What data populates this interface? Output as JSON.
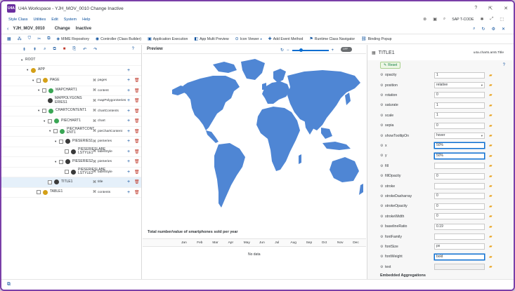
{
  "window": {
    "app_icon_text": "U4A",
    "title": "U4A Workspace - YJH_MOV_0010 Change Inactive",
    "controls": [
      "?",
      "⇱",
      "✕"
    ]
  },
  "menu": {
    "items": [
      "Style Class",
      "Utilities",
      "Edit",
      "System",
      "Help"
    ],
    "tcode_placeholder": "SAP T-CODE"
  },
  "header": {
    "title": "YJH_MOV_0010",
    "mode": "Change",
    "status": "Inactive"
  },
  "toolbar": {
    "items": [
      {
        "icon": "grid-icon",
        "label": ""
      },
      {
        "icon": "code-icon",
        "label": ""
      },
      {
        "icon": "shield-icon",
        "label": ""
      },
      {
        "icon": "scissors-icon",
        "label": ""
      },
      {
        "icon": "copy-icon",
        "label": ""
      },
      {
        "icon": "cube-icon",
        "label": "MIME Repository"
      },
      {
        "icon": "controller-icon",
        "label": "Controller (Class Builder)"
      },
      {
        "icon": "run-icon",
        "label": "Application Execution"
      },
      {
        "icon": "multi-preview-icon",
        "label": "App Multi Preview"
      },
      {
        "icon": "icon-viewer-icon",
        "label": "Icon Viewer"
      },
      {
        "icon": "event-icon",
        "label": "Add Event Method"
      },
      {
        "icon": "runtime-icon",
        "label": "Runtime Class Navigator"
      },
      {
        "icon": "binding-icon",
        "label": "Binding Popup"
      }
    ]
  },
  "tree": {
    "nodes": [
      {
        "name": "ROOT",
        "level": 0,
        "expanded": true,
        "checkbox": false,
        "bind": "",
        "icon_color": ""
      },
      {
        "name": "APP",
        "level": 1,
        "expanded": true,
        "checkbox": false,
        "bind": "",
        "icon_color": "#d4a017"
      },
      {
        "name": "PAGE",
        "level": 2,
        "expanded": true,
        "checkbox": true,
        "bind": "pages",
        "icon_color": "#d4a017"
      },
      {
        "name": "MAPCHART1",
        "level": 3,
        "expanded": true,
        "checkbox": true,
        "bind": "content",
        "icon_color": "#3aa655"
      },
      {
        "name": "MAPPOLYGONSERIES1",
        "level": 4,
        "expanded": false,
        "checkbox": false,
        "bind": "mapPolygonSeries",
        "icon_color": "#3a3a3a"
      },
      {
        "name": "CHARTCONTENT1",
        "level": 3,
        "expanded": true,
        "checkbox": true,
        "bind": "chartContents",
        "icon_color": "#3aa655"
      },
      {
        "name": "PIECHART1",
        "level": 4,
        "expanded": true,
        "checkbox": true,
        "bind": "chart",
        "icon_color": "#3aa655"
      },
      {
        "name": "PIECHARTCONTENT1",
        "level": 5,
        "expanded": true,
        "checkbox": true,
        "bind": "pieChartContent",
        "icon_color": "#3aa655"
      },
      {
        "name": "PIESERIES1",
        "level": 6,
        "expanded": true,
        "checkbox": true,
        "bind": "pieSeries",
        "icon_color": "#3a3a3a"
      },
      {
        "name": "PIESERIESLABELSTYLE1",
        "level": 7,
        "expanded": false,
        "checkbox": true,
        "bind": "labelStyle",
        "icon_color": "#3a3a3a"
      },
      {
        "name": "PIESERIES2",
        "level": 6,
        "expanded": true,
        "checkbox": true,
        "bind": "pieSeries",
        "icon_color": "#3a3a3a"
      },
      {
        "name": "PIESERIESLABELSTYLE2",
        "level": 7,
        "expanded": false,
        "checkbox": true,
        "bind": "labelStyle",
        "icon_color": "#3a3a3a"
      },
      {
        "name": "TITLE1",
        "level": 4,
        "expanded": false,
        "checkbox": true,
        "bind": "title",
        "icon_color": "#3a3a3a",
        "selected": true
      },
      {
        "name": "TABLE1",
        "level": 2,
        "expanded": false,
        "checkbox": true,
        "bind": "contents",
        "icon_color": "#d4a017"
      }
    ]
  },
  "preview": {
    "label": "Preview",
    "toggle_label": "OFF",
    "chart_title": "Total number/value of smartphones sold per year",
    "months": [
      "Jan",
      "Feb",
      "Mar",
      "Apr",
      "May",
      "Jun",
      "Jul",
      "Aug",
      "Sep",
      "Oct",
      "Nov",
      "Dec"
    ],
    "no_data": "No data",
    "map_color": "#4f86d4"
  },
  "properties": {
    "title": "TITLE1",
    "path": "u4a.charts.am5.Title",
    "reset_label": "Reset",
    "rows": [
      {
        "name": "opacity",
        "value": "1",
        "type": "input"
      },
      {
        "name": "position",
        "value": "relative",
        "type": "select"
      },
      {
        "name": "rotation",
        "value": "0",
        "type": "input"
      },
      {
        "name": "saturate",
        "value": "1",
        "type": "input"
      },
      {
        "name": "scale",
        "value": "1",
        "type": "input"
      },
      {
        "name": "sepia",
        "value": "0",
        "type": "input"
      },
      {
        "name": "showTooltipOn",
        "value": "hover",
        "type": "select"
      },
      {
        "name": "x",
        "value": "50%",
        "type": "focus"
      },
      {
        "name": "y",
        "value": "50%",
        "type": "focus"
      },
      {
        "name": "fill",
        "value": "",
        "type": "input"
      },
      {
        "name": "fillOpacity",
        "value": "0",
        "type": "input"
      },
      {
        "name": "stroke",
        "value": "",
        "type": "input"
      },
      {
        "name": "strokeDasharray",
        "value": "0",
        "type": "input"
      },
      {
        "name": "strokeOpacity",
        "value": "0",
        "type": "input"
      },
      {
        "name": "strokeWidth",
        "value": "0",
        "type": "input"
      },
      {
        "name": "baselineRatio",
        "value": "0.19",
        "type": "input"
      },
      {
        "name": "fontFamily",
        "value": "",
        "type": "input"
      },
      {
        "name": "fontSize",
        "value": "px",
        "type": "input"
      },
      {
        "name": "fontWeight",
        "value": "bold",
        "type": "focus"
      },
      {
        "name": "text",
        "value": "",
        "type": "empty"
      }
    ],
    "embedded_aggregations_label": "Embedded Aggregations",
    "aggregation_row": "title"
  },
  "colors": {
    "accent": "#0a6ed1",
    "frame": "#7a3fa8",
    "selection": "#e5f0fa",
    "folder": "#e9a21a",
    "delete": "#c0392b"
  }
}
